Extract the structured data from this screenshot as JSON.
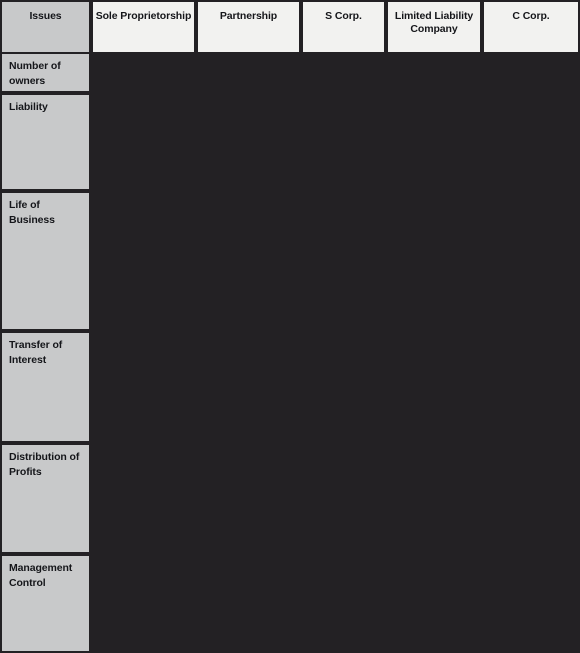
{
  "table": {
    "columns": [
      "Issues",
      "Sole Proprietorship",
      "Partnership",
      "S Corp.",
      "Limited Liability Company",
      "C Corp."
    ],
    "rows": [
      {
        "label": "Number of owners",
        "cells": [
          "",
          "",
          "",
          "",
          ""
        ]
      },
      {
        "label": "Liability",
        "cells": [
          "",
          "",
          "",
          "",
          ""
        ]
      },
      {
        "label": "Life of Business",
        "cells": [
          "",
          "",
          "",
          "",
          ""
        ]
      },
      {
        "label": "Transfer of Interest",
        "cells": [
          "",
          "",
          "",
          "",
          ""
        ]
      },
      {
        "label": "Distribution of Profits",
        "cells": [
          "",
          "",
          "",
          "",
          ""
        ]
      },
      {
        "label": "Management Control",
        "cells": [
          "",
          "",
          "",
          "",
          ""
        ]
      }
    ]
  },
  "colors": {
    "background": "#232124",
    "header_fill": "#f2f2f0",
    "label_fill": "#c8c9ca",
    "text": "#15161a"
  }
}
